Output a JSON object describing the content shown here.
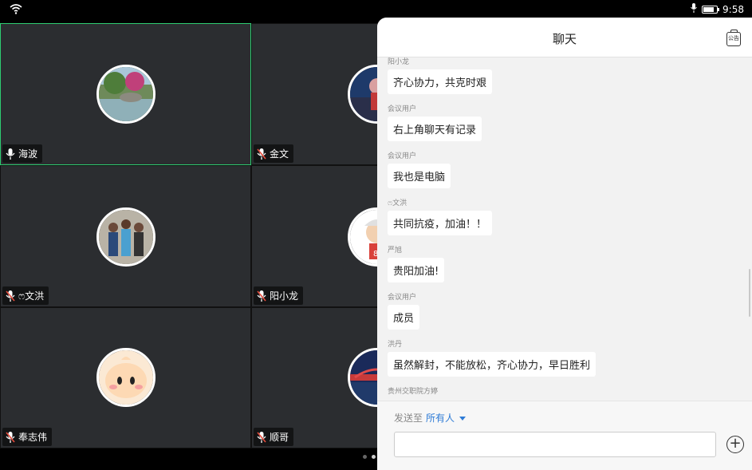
{
  "status_bar": {
    "time": "9:58",
    "battery_level": 0.8
  },
  "tiles": [
    {
      "name": "海波",
      "active": true
    },
    {
      "name": "金文",
      "active": false
    },
    {
      "name": "ෆ文洪",
      "active": false
    },
    {
      "name": "阳小龙",
      "active": false
    },
    {
      "name": "奉志伟",
      "active": false
    },
    {
      "name": "顺哥",
      "active": false
    }
  ],
  "chat": {
    "title": "聊天",
    "notice_icon": "notice-board-icon",
    "notice_label": "公告",
    "messages": [
      {
        "sender": "阳小龙",
        "text": "齐心协力，共克时艰"
      },
      {
        "sender": "会议用户",
        "text": "右上角聊天有记录"
      },
      {
        "sender": "会议用户",
        "text": "我也是电脑"
      },
      {
        "sender": "ෆ文洪",
        "text": "共同抗疫，加油！！"
      },
      {
        "sender": "严旭",
        "text": "贵阳加油!"
      },
      {
        "sender": "会议用户",
        "text": "成员"
      },
      {
        "sender": "洪丹",
        "text": "虽然解封，不能放松，齐心协力，早日胜利"
      },
      {
        "sender": "贵州交职院方婷",
        "text": ""
      }
    ],
    "send_to_label": "发送至",
    "send_to_target": "所有人",
    "input_value": ""
  },
  "colors": {
    "accent": "#2e7bd6",
    "active_border": "#2ecc71",
    "tile_bg": "#2b2d30"
  }
}
